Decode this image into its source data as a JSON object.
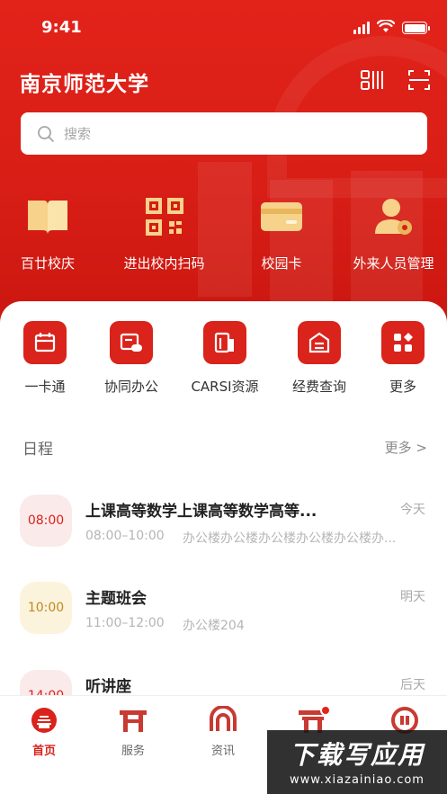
{
  "status_bar": {
    "time": "9:41"
  },
  "header": {
    "title": "南京师范大学"
  },
  "search": {
    "placeholder": "搜索"
  },
  "quick_actions": [
    {
      "label": "百廿校庆",
      "icon": "book-icon"
    },
    {
      "label": "进出校内扫码",
      "icon": "qr-code-icon"
    },
    {
      "label": "校园卡",
      "icon": "card-icon"
    },
    {
      "label": "外来人员管理",
      "icon": "user-gear-icon"
    }
  ],
  "services": [
    {
      "label": "一卡通",
      "icon": "calendar-card-icon"
    },
    {
      "label": "协同办公",
      "icon": "collaboration-icon"
    },
    {
      "label": "CARSI资源",
      "icon": "resource-icon"
    },
    {
      "label": "经费查询",
      "icon": "funds-icon"
    },
    {
      "label": "更多",
      "icon": "more-grid-icon"
    }
  ],
  "schedule": {
    "title": "日程",
    "more": "更多 >",
    "items": [
      {
        "badge": "08:00",
        "title": "上课高等数学上课高等数学高等...",
        "day": "今天",
        "time": "08:00–10:00",
        "location": "办公楼办公楼办公楼办公楼办公楼办..."
      },
      {
        "badge": "10:00",
        "title": "主题班会",
        "day": "明天",
        "time": "11:00–12:00",
        "location": "办公楼204"
      },
      {
        "badge": "14:00",
        "title": "听讲座",
        "day": "后天",
        "time": "",
        "location": ""
      }
    ]
  },
  "tabs": [
    {
      "label": "首页",
      "icon": "home-icon",
      "active": true
    },
    {
      "label": "服务",
      "icon": "service-icon"
    },
    {
      "label": "资讯",
      "icon": "news-icon"
    },
    {
      "label": "",
      "icon": "gate-icon"
    },
    {
      "label": "",
      "icon": "profile-icon"
    }
  ],
  "watermark": {
    "line1": "下载写应用",
    "line2": "www.xiazainiao.com"
  },
  "colors": {
    "brand_red": "#d9231b",
    "badge_pink": "#fbeaea",
    "badge_yellow": "#fbf3dc"
  }
}
